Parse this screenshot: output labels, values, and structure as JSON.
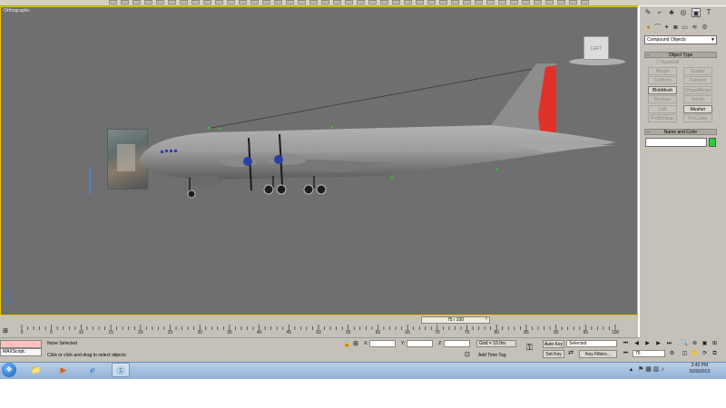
{
  "viewport": {
    "label": "Orthographic",
    "view_cube_label": "LEFT"
  },
  "panel": {
    "dropdown_value": "Compound Objects",
    "object_type_title": "Object Type",
    "autogrid_label": "AutoGrid",
    "buttons": [
      "Morph",
      "Scatter",
      "Conform",
      "Connect",
      "BlobMesh",
      "ShapeMerge",
      "Boolean",
      "Terrain",
      "Loft",
      "Mesher",
      "ProBoolean",
      "ProCutter"
    ],
    "name_color_title": "Name and Color",
    "name_value": "",
    "swatch_color": "#2ecc3a"
  },
  "timeline": {
    "slider_label": "75 / 100",
    "ticks": [
      "0",
      "5",
      "10",
      "15",
      "20",
      "25",
      "30",
      "35",
      "40",
      "45",
      "50",
      "55",
      "60",
      "65",
      "70",
      "75",
      "80",
      "85",
      "90",
      "95",
      "100"
    ]
  },
  "status": {
    "script_label": "MAXScript.",
    "selection": "None Selected",
    "prompt": "Click or click-and-drag to select objects",
    "x_label": "X:",
    "y_label": "Y:",
    "z_label": "Z:",
    "grid": "Grid = 10.0m",
    "add_time_tag": "Add Time Tag",
    "auto_key": "Auto Key",
    "set_key": "Set Key",
    "key_mode": "Selected",
    "key_filters": "Key Filters...",
    "frame": "75"
  },
  "taskbar": {
    "time": "2:42 PM",
    "date": "5/29/2013"
  },
  "colors": {
    "viewport_bg": "#6f6f6f",
    "tail_red": "#e0322a",
    "border_active": "#f0c000"
  }
}
